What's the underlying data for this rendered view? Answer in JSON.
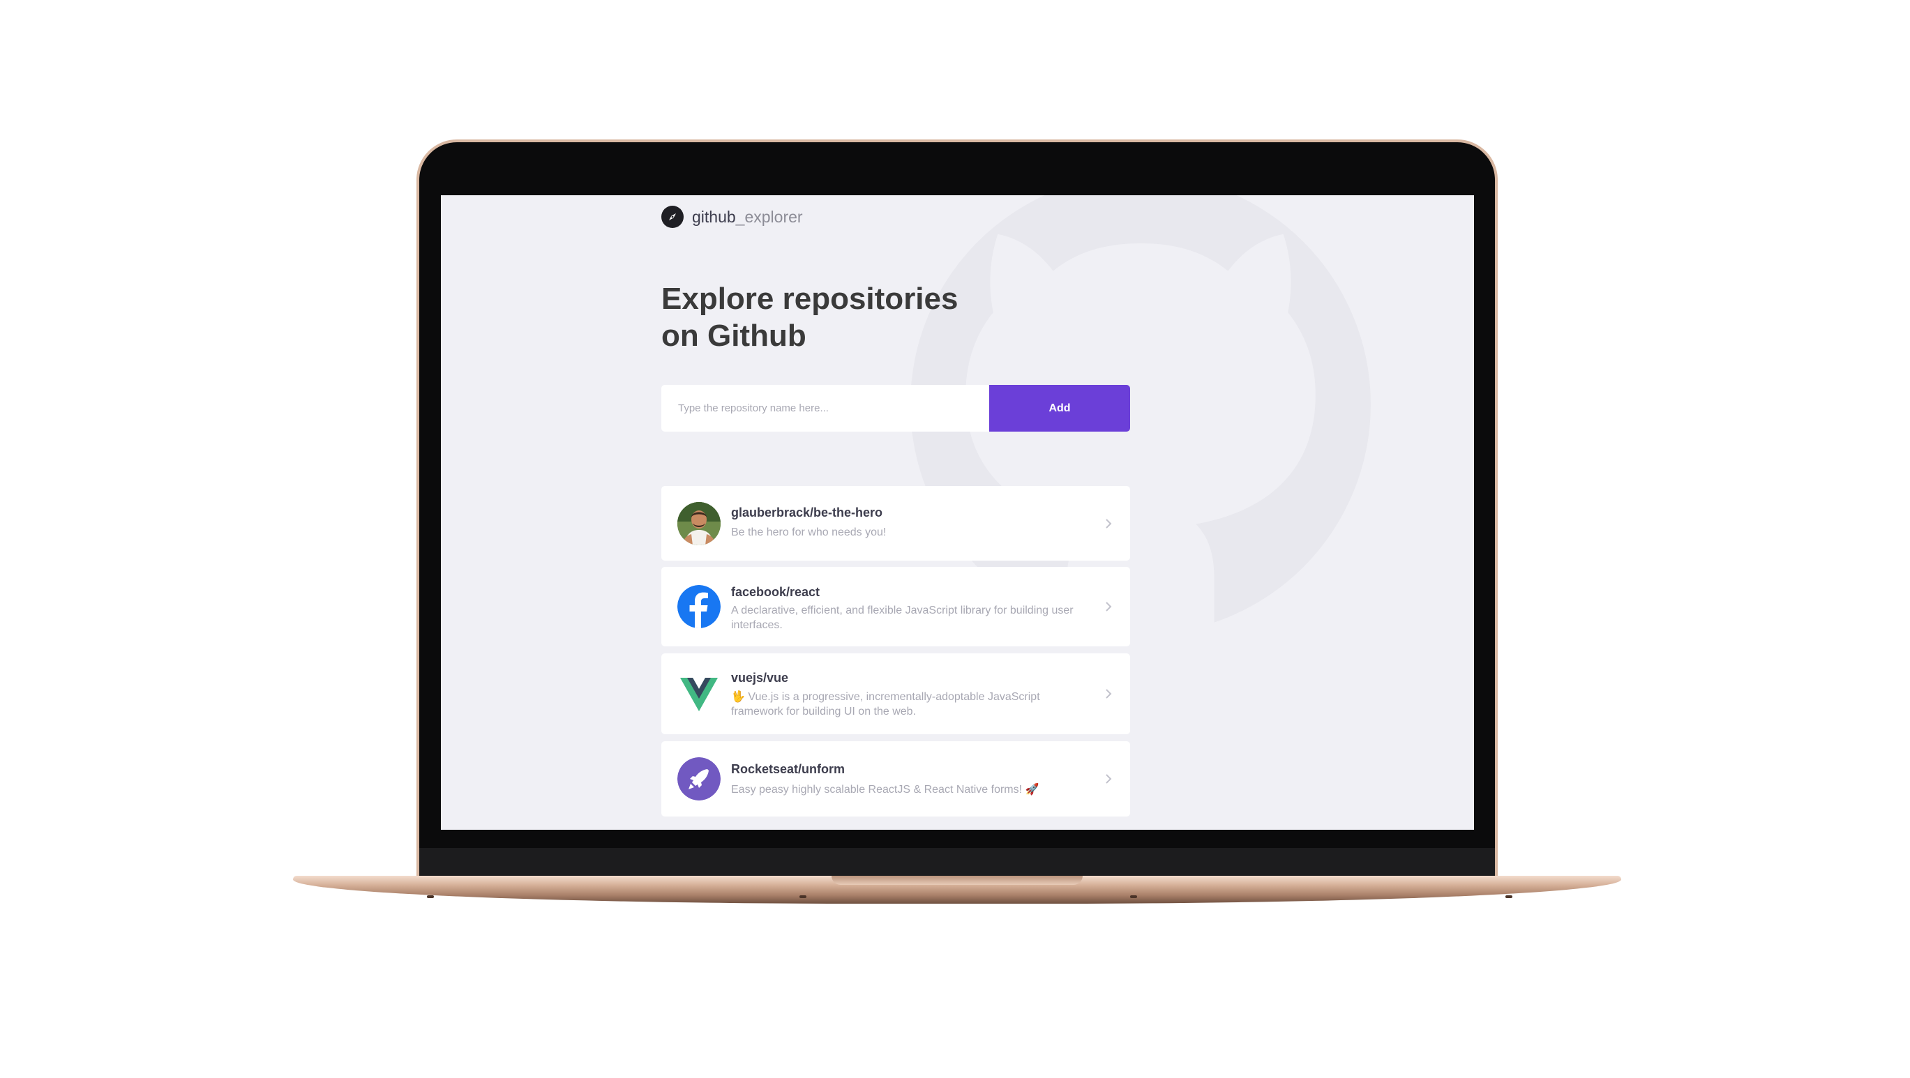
{
  "app": {
    "brand_prefix": "github",
    "brand_suffix": "_explorer"
  },
  "hero": {
    "title_line1": "Explore repositories",
    "title_line2": "on Github"
  },
  "search": {
    "placeholder": "Type the repository name here...",
    "value": "",
    "button_label": "Add"
  },
  "colors": {
    "accent": "#6b3fd8",
    "background": "#f0f0f5",
    "card": "#ffffff",
    "title": "#3a3a3a",
    "muted": "#a8a8b3"
  },
  "repositories": [
    {
      "name": "glauberbrack/be-the-hero",
      "description": "Be the hero for who needs you!",
      "avatar": "user-photo-avatar"
    },
    {
      "name": "facebook/react",
      "description": "A declarative, efficient, and flexible JavaScript library for building user interfaces.",
      "avatar": "facebook-logo"
    },
    {
      "name": "vuejs/vue",
      "description": "🖖 Vue.js is a progressive, incrementally-adoptable JavaScript framework for building UI on the web.",
      "avatar": "vue-logo"
    },
    {
      "name": "Rocketseat/unform",
      "description": "Easy peasy highly scalable ReactJS & React Native forms! 🚀",
      "avatar": "rocket-logo"
    }
  ]
}
